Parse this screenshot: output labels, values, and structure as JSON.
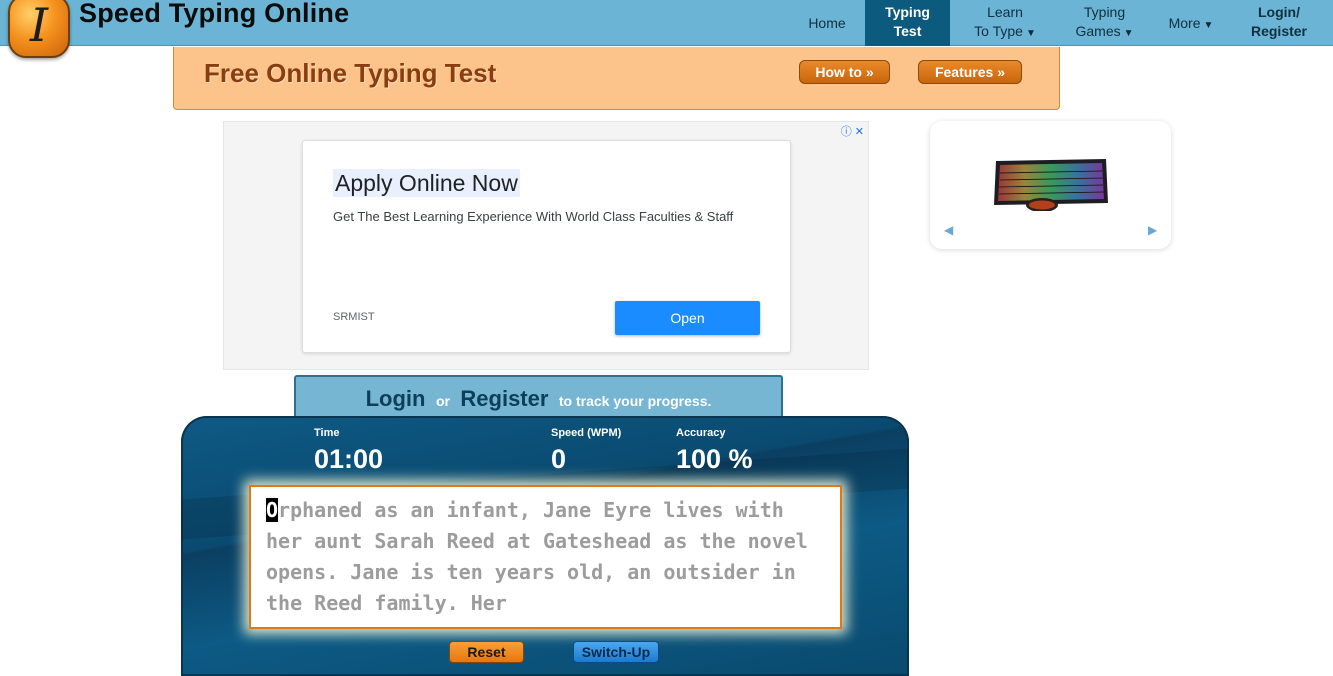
{
  "brand": {
    "logo_letter": "I",
    "name": "Speed Typing Online"
  },
  "nav": {
    "home": "Home",
    "typing_test": [
      "Typing",
      "Test"
    ],
    "learn": [
      "Learn",
      "To Type"
    ],
    "typing_games": [
      "Typing",
      "Games"
    ],
    "more": "More",
    "login_register": [
      "Login/",
      "Register"
    ],
    "caret": "▼"
  },
  "banner": {
    "title": "Free Online Typing Test",
    "howto": "How to »",
    "features": "Features »"
  },
  "ad": {
    "title": "Apply Online Now",
    "description": "Get The Best Learning Experience With World Class Faculties & Staff",
    "sponsor": "SRMIST",
    "cta": "Open",
    "icons": "ⓘ ✕"
  },
  "product": {
    "prev": "◀",
    "next": "▶",
    "image_icon": "gaming-keyboard-and-mouse"
  },
  "login_bar": {
    "login": "Login",
    "or": "or",
    "register": "Register",
    "suffix": "to track your progress."
  },
  "stats": {
    "time_label": "Time",
    "time_value": "01:00",
    "speed_label": "Speed (WPM)",
    "speed_value": "0",
    "accuracy_label": "Accuracy",
    "accuracy_value": "100 %"
  },
  "typing": {
    "current_char": "O",
    "text": "rphaned as an infant, Jane Eyre lives with her aunt Sarah Reed at Gateshead as the novel opens. Jane is ten years old, an outsider in the Reed family. Her"
  },
  "buttons": {
    "reset": "Reset",
    "switch_up": "Switch-Up"
  },
  "colors": {
    "nav": "#6bb4d5",
    "nav_active": "#0c5a7d",
    "banner": "#fcc48b",
    "panel": "#0c5a85",
    "accent": "#e07a10"
  }
}
